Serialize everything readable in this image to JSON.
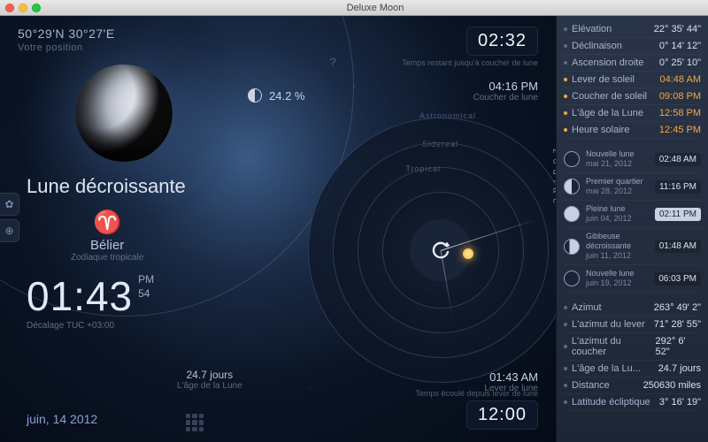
{
  "window": {
    "title": "Deluxe Moon"
  },
  "coords": {
    "value": "50°29'N 30°27'E",
    "label": "Votre position"
  },
  "phase_name": "Lune décroissante",
  "zodiac": {
    "glyph": "♈",
    "name": "Bélier",
    "kind": "Zodiaque tropicale"
  },
  "clock": {
    "hm": "01:43",
    "ampm": "PM",
    "sec": "54",
    "offset": "Décalage TUC +03:00"
  },
  "date": "juin, 14 2012",
  "age": {
    "value": "24.7 jours",
    "label": "L'âge de la Lune"
  },
  "illumination": "24.2 %",
  "timer": {
    "value": "02:32",
    "label": "Temps restant jusqu'à coucher de lune"
  },
  "moonset": {
    "time": "04:16 PM",
    "label": "Coucher de lune"
  },
  "moonrise": {
    "time": "01:43 AM",
    "label": "Lever de lune"
  },
  "elapsed": {
    "value": "12:00",
    "label": "Temps écoulé depuis lever de lune"
  },
  "dial": {
    "ring1": "Astronomical",
    "ring2": "Sidereal",
    "ring3": "Tropical",
    "arc": "zodiac"
  },
  "sidebar": {
    "block1": [
      {
        "label": "Elévation",
        "value": "22° 35' 44\""
      },
      {
        "label": "Déclinaison",
        "value": "0° 14' 12\""
      },
      {
        "label": "Ascension droite",
        "value": "0° 25' 10\""
      }
    ],
    "block2": [
      {
        "label": "Lever de soleil",
        "value": "04:48 AM"
      },
      {
        "label": "Coucher de soleil",
        "value": "09:08 PM"
      },
      {
        "label": "L'âge de la Lune",
        "value": "12:58 PM"
      },
      {
        "label": "Heure solaire",
        "value": "12:45 PM"
      }
    ],
    "phases": [
      {
        "icon": "new",
        "name": "Nouvelle lune",
        "date": "mai 21, 2012",
        "time": "02:48 AM"
      },
      {
        "icon": "fq",
        "name": "Premier quartier",
        "date": "mai 28, 2012",
        "time": "11:16 PM"
      },
      {
        "icon": "full",
        "name": "Pleine lune",
        "date": "juin 04, 2012",
        "time": "02:11 PM",
        "hl": true
      },
      {
        "icon": "wg",
        "name": "Gibbeuse décroissante",
        "date": "juin 11, 2012",
        "time": "01:48 AM"
      },
      {
        "icon": "new",
        "name": "Nouvelle lune",
        "date": "juin 19, 2012",
        "time": "06:03 PM"
      }
    ],
    "block3": [
      {
        "label": "Azimut",
        "value": "263° 49' 2\""
      },
      {
        "label": "L'azimut du lever",
        "value": "71° 28' 55\""
      },
      {
        "label": "L'azimut du coucher",
        "value": "292° 6' 52\""
      },
      {
        "label": "L'âge de la Lu...",
        "value": "24.7 jours"
      },
      {
        "label": "Distance",
        "value": "250630 miles"
      },
      {
        "label": "Latitude écliptique",
        "value": "3° 16' 19\""
      }
    ]
  }
}
